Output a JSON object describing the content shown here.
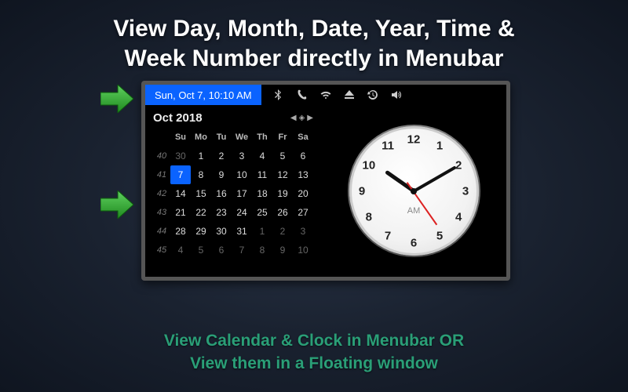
{
  "headline_line1": "View Day, Month, Date, Year, Time &",
  "headline_line2": "Week Number directly in Menubar",
  "subheadline_line1": "View Calendar & Clock in Menubar OR",
  "subheadline_line2": "View them in a Floating window",
  "menubar": {
    "date_text": "Sun, Oct 7, 10:10 AM"
  },
  "calendar": {
    "title": "Oct 2018",
    "dow": [
      "Su",
      "Mo",
      "Tu",
      "We",
      "Th",
      "Fr",
      "Sa"
    ],
    "weeks": [
      {
        "wk": "40",
        "days": [
          {
            "n": "30",
            "other": true
          },
          {
            "n": "1"
          },
          {
            "n": "2"
          },
          {
            "n": "3"
          },
          {
            "n": "4"
          },
          {
            "n": "5"
          },
          {
            "n": "6"
          }
        ]
      },
      {
        "wk": "41",
        "days": [
          {
            "n": "7",
            "today": true
          },
          {
            "n": "8"
          },
          {
            "n": "9"
          },
          {
            "n": "10"
          },
          {
            "n": "11"
          },
          {
            "n": "12"
          },
          {
            "n": "13"
          }
        ]
      },
      {
        "wk": "42",
        "days": [
          {
            "n": "14"
          },
          {
            "n": "15"
          },
          {
            "n": "16"
          },
          {
            "n": "17"
          },
          {
            "n": "18"
          },
          {
            "n": "19"
          },
          {
            "n": "20"
          }
        ]
      },
      {
        "wk": "43",
        "days": [
          {
            "n": "21"
          },
          {
            "n": "22"
          },
          {
            "n": "23"
          },
          {
            "n": "24"
          },
          {
            "n": "25"
          },
          {
            "n": "26"
          },
          {
            "n": "27"
          }
        ]
      },
      {
        "wk": "44",
        "days": [
          {
            "n": "28"
          },
          {
            "n": "29"
          },
          {
            "n": "30"
          },
          {
            "n": "31"
          },
          {
            "n": "1",
            "other": true
          },
          {
            "n": "2",
            "other": true
          },
          {
            "n": "3",
            "other": true
          }
        ]
      },
      {
        "wk": "45",
        "days": [
          {
            "n": "4",
            "other": true
          },
          {
            "n": "5",
            "other": true
          },
          {
            "n": "6",
            "other": true
          },
          {
            "n": "7",
            "other": true
          },
          {
            "n": "8",
            "other": true
          },
          {
            "n": "9",
            "other": true
          },
          {
            "n": "10",
            "other": true
          }
        ]
      }
    ]
  },
  "clock": {
    "ampm": "AM",
    "numbers": [
      "12",
      "1",
      "2",
      "3",
      "4",
      "5",
      "6",
      "7",
      "8",
      "9",
      "10",
      "11"
    ],
    "hour_angle": 305,
    "minute_angle": 60,
    "second_angle": 145
  }
}
